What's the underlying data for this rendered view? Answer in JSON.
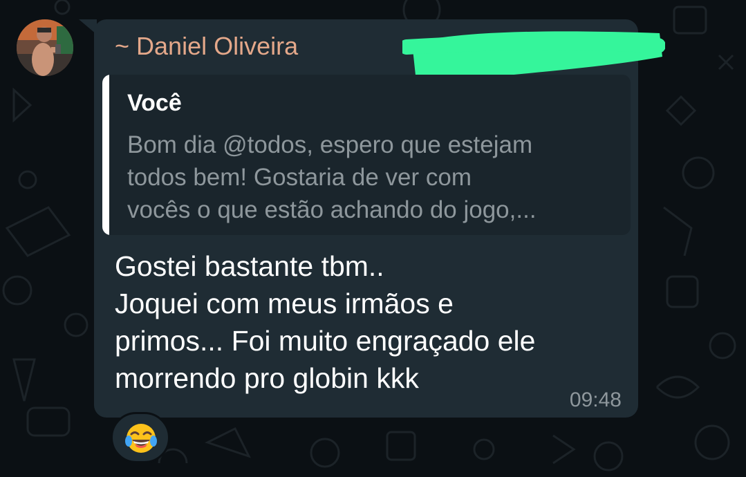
{
  "chat": {
    "sender_name": "~ Daniel Oliveira",
    "quoted": {
      "author": "Você",
      "lines": [
        "Bom dia @todos, espero que estejam",
        "todos bem! Gostaria de ver com",
        "vocês o que estão achando do jogo,..."
      ]
    },
    "message_lines": [
      "Gostei bastante tbm..",
      "Joquei com meus irmãos e",
      "primos... Foi muito engraçado ele",
      "morrendo pro globin kkk"
    ],
    "time": "09:48",
    "reaction": {
      "emoji": "😂",
      "icon": "face-with-tears-of-joy-icon"
    }
  },
  "colors": {
    "background": "#0b1014",
    "bubble": "#1f2c34",
    "quote_background": "#1a252c",
    "sender_name": "#e4a88a",
    "quote_text": "#8e979c",
    "redaction": "#35f59b"
  },
  "icons": {
    "avatar": "contact-photo",
    "wallpaper": "doodle-pattern"
  }
}
